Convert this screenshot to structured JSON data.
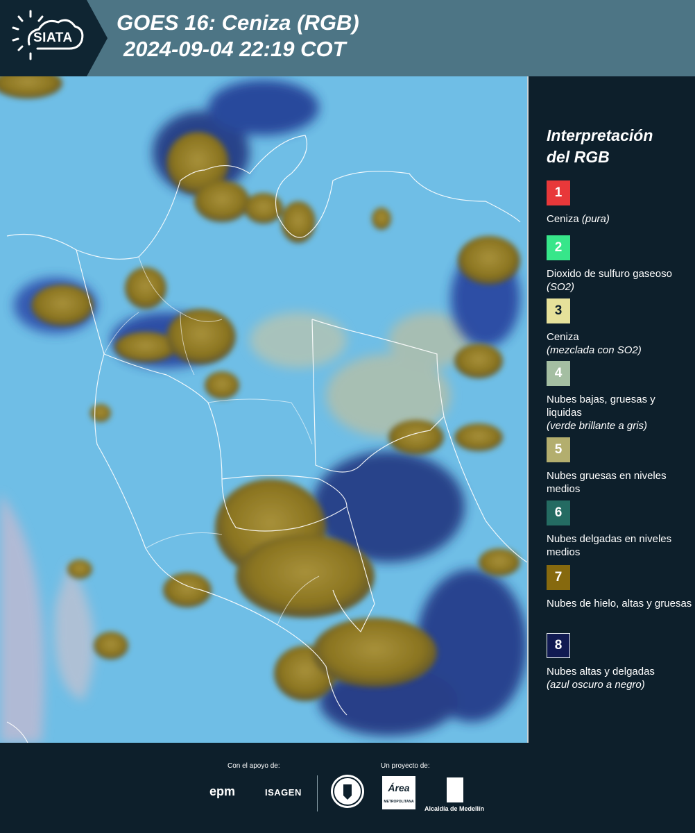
{
  "header": {
    "logo_text": "SIATA",
    "title_line1": "GOES 16: Ceniza (RGB)",
    "title_line2": "2024-09-04 22:19 COT"
  },
  "legend": {
    "title_line1": "Interpretación",
    "title_line2": "del RGB",
    "items": [
      {
        "num": "1",
        "color": "#e8383a",
        "label": "Ceniza ",
        "note": "(pura)"
      },
      {
        "num": "2",
        "color": "#37e68a",
        "label": "Dioxido de sulfuro gaseoso ",
        "note": "(SO2)"
      },
      {
        "num": "3",
        "color": "#e6e19a",
        "label": "Ceniza",
        "note": "(mezclada con SO2)"
      },
      {
        "num": "4",
        "color": "#a4bea2",
        "label": "Nubes bajas, gruesas y liquidas",
        "note": "(verde brillante a gris)"
      },
      {
        "num": "5",
        "color": "#b3ae6e",
        "label": "Nubes gruesas en niveles medios",
        "note": ""
      },
      {
        "num": "6",
        "color": "#246b62",
        "label": "Nubes delgadas en niveles medios",
        "note": ""
      },
      {
        "num": "7",
        "color": "#86690e",
        "label": "Nubes de hielo, altas y gruesas",
        "note": ""
      },
      {
        "num": "8",
        "color": "#111a52",
        "label": "Nubes altas y delgadas",
        "note": "(azul oscuro a negro)"
      }
    ]
  },
  "footer": {
    "support_label": "Con el apoyo de:",
    "project_label": "Un proyecto de:",
    "epm": "epm",
    "isagen": "ISAGEN",
    "area_logo": "Área",
    "area_sub": "METROPOLITANA",
    "alcaldia": "Alcaldía de Medellín"
  },
  "colors": {
    "header_bg": "#4d7585",
    "logo_bg": "#0f2532",
    "panel_bg": "#0d1f2b",
    "map_base": "#6fbee6",
    "ice_cloud": "#8a7420",
    "high_thin_cloud": "#1c2d7a"
  }
}
